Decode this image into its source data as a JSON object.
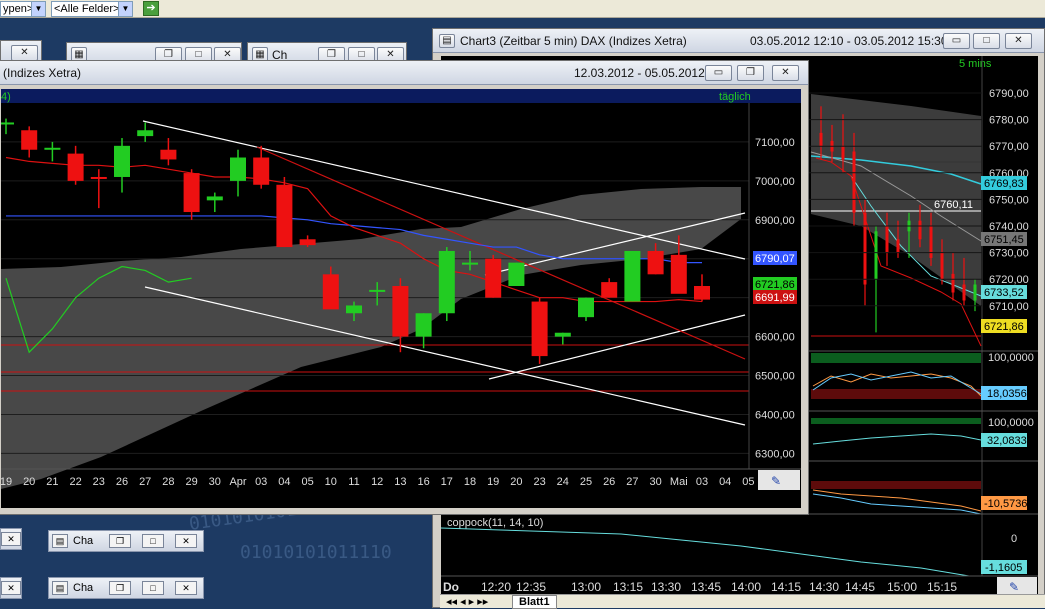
{
  "toolbar": {
    "combo1": "ypen>",
    "combo2": "<Alle Felder>",
    "go_arrow": "➔"
  },
  "background_windows": {
    "items": [
      {
        "title": "Cha"
      },
      {
        "title": "Cha"
      }
    ],
    "bg_titles": [
      "",
      "",
      "Ch"
    ]
  },
  "main_window": {
    "title": "(Indizes Xetra)",
    "date_range": "12.03.2012 - 05.05.2012",
    "legend_left": "4)",
    "interval": "täglich",
    "y_ticks": [
      "7100,00",
      "7000,00",
      "6900,00",
      "6800,00",
      "6700,00",
      "6600,00",
      "6500,00",
      "6400,00",
      "6300,00"
    ],
    "badges": {
      "blue": "6790,07",
      "green": "6721,86",
      "red": "6691,99"
    },
    "x_labels": [
      "19",
      "20",
      "21",
      "22",
      "23",
      "26",
      "27",
      "28",
      "29",
      "30",
      "Apr",
      "03",
      "04",
      "05",
      "10",
      "11",
      "12",
      "13",
      "16",
      "17",
      "18",
      "19",
      "20",
      "23",
      "24",
      "25",
      "26",
      "27",
      "30",
      "Mai",
      "03",
      "04",
      "05"
    ]
  },
  "chart3_window": {
    "title": "Chart3 (Zeitbar 5 min)  DAX (Indizes Xetra)",
    "date_range": "03.05.2012 12:10 - 03.05.2012 15:30",
    "interval": "5 mins",
    "y_ticks": [
      "6790,00",
      "6780,00",
      "6770,00",
      "6760,00",
      "6750,00",
      "6740,00",
      "6730,00",
      "6720,00",
      "6710,00"
    ],
    "badges": {
      "cyan": "6769,83",
      "white_label": "6760,11",
      "gray": "6751,45",
      "lightcyan": "6733,52",
      "yellow": "6721,86"
    },
    "ind1": {
      "top": "100,0000",
      "value": "18,0356"
    },
    "ind2": {
      "top": "100,0000",
      "value": "32,0833"
    },
    "ind3": {
      "value": "-10,5736"
    },
    "coppock": {
      "label": "coppock(11, 14, 10)",
      "zero": "0",
      "value": "-1,1605"
    },
    "x_labels": [
      "Do",
      "12:20",
      "12:35",
      "13:00",
      "13:15",
      "13:30",
      "13:45",
      "14:00",
      "14:15",
      "14:30",
      "14:45",
      "15:00",
      "15:15"
    ],
    "sheet_tab": "Blatt1"
  },
  "colors": {
    "bull": "#22cc22",
    "bear": "#ee1111",
    "cloud": "#4a4a4a",
    "ma_blue": "#3355ff",
    "ma_red": "#dd1111",
    "line_green": "#22cc22",
    "trend": "#ffffff"
  },
  "chart_data": {
    "type": "candlestick",
    "categories": [
      "19",
      "20",
      "21",
      "22",
      "23",
      "26",
      "27",
      "28",
      "29",
      "30",
      "Apr",
      "03",
      "04",
      "05",
      "10",
      "11",
      "12",
      "13",
      "16",
      "17",
      "18",
      "19",
      "20",
      "23",
      "24",
      "25",
      "26",
      "27",
      "30",
      "Mai",
      "03"
    ],
    "ohlc": [
      [
        7145,
        7160,
        7120,
        7150
      ],
      [
        7130,
        7140,
        7060,
        7080
      ],
      [
        7080,
        7100,
        7050,
        7085
      ],
      [
        7070,
        7090,
        6990,
        7000
      ],
      [
        7010,
        7030,
        6930,
        7005
      ],
      [
        7010,
        7110,
        6970,
        7090
      ],
      [
        7115,
        7150,
        7100,
        7130
      ],
      [
        7080,
        7110,
        7040,
        7055
      ],
      [
        7020,
        7030,
        6900,
        6920
      ],
      [
        6950,
        6970,
        6920,
        6960
      ],
      [
        7000,
        7080,
        6960,
        7060
      ],
      [
        7060,
        7090,
        6980,
        6990
      ],
      [
        6990,
        7010,
        6830,
        6830
      ],
      [
        6850,
        6860,
        6830,
        6835
      ],
      [
        6760,
        6780,
        6680,
        6670
      ],
      [
        6660,
        6690,
        6640,
        6680
      ],
      [
        6720,
        6740,
        6680,
        6720
      ],
      [
        6730,
        6750,
        6560,
        6600
      ],
      [
        6600,
        6660,
        6570,
        6660
      ],
      [
        6660,
        6830,
        6640,
        6820
      ],
      [
        6790,
        6820,
        6770,
        6790
      ],
      [
        6800,
        6810,
        6700,
        6700
      ],
      [
        6730,
        6790,
        6730,
        6790
      ],
      [
        6690,
        6700,
        6530,
        6550
      ],
      [
        6600,
        6610,
        6580,
        6610
      ],
      [
        6650,
        6700,
        6640,
        6700
      ],
      [
        6740,
        6750,
        6700,
        6700
      ],
      [
        6690,
        6820,
        6690,
        6820
      ],
      [
        6820,
        6840,
        6760,
        6760
      ],
      [
        6810,
        6860,
        6720,
        6710
      ],
      [
        6730,
        6760,
        6690,
        6695
      ]
    ],
    "series": [
      {
        "name": "ma_blue",
        "values": [
          6910,
          6910,
          6910,
          6910,
          6910,
          6910,
          6910,
          6910,
          6910,
          6910,
          6910,
          6910,
          6905,
          6900,
          6890,
          6885,
          6880,
          6875,
          6860,
          6850,
          6840,
          6830,
          6830,
          6810,
          6800,
          6800,
          6800,
          6800,
          6800,
          6790,
          6790
        ]
      },
      {
        "name": "ma_red",
        "values": [
          7060,
          7050,
          7045,
          7040,
          7040,
          7035,
          7040,
          7030,
          7020,
          7010,
          7010,
          7005,
          6995,
          6980,
          6910,
          6880,
          6860,
          6840,
          6800,
          6770,
          6760,
          6740,
          6720,
          6700,
          6700,
          6690,
          6690,
          6690,
          6690,
          6695,
          6690
        ]
      },
      {
        "name": "line_green",
        "values": [
          6750,
          6560,
          6620,
          6700,
          6750,
          6780,
          6770,
          6740,
          6750
        ]
      }
    ],
    "ylim": [
      6260,
      7200
    ]
  }
}
